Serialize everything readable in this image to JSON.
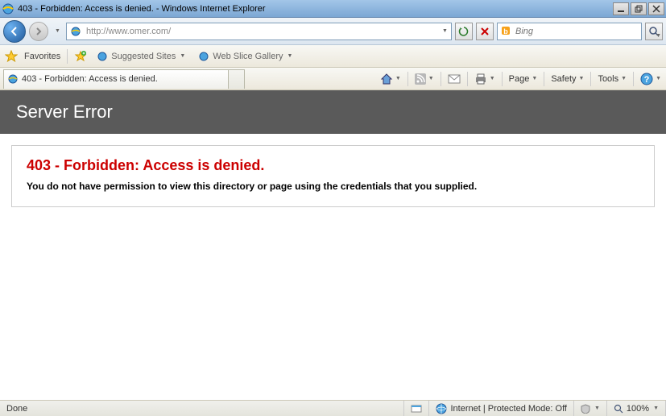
{
  "window": {
    "title": "403 - Forbidden: Access is denied. - Windows Internet Explorer"
  },
  "address": {
    "url": "http://www.omer.com/"
  },
  "search": {
    "placeholder": "Bing"
  },
  "favorites": {
    "label": "Favorites",
    "suggested": "Suggested Sites",
    "webslice": "Web Slice Gallery"
  },
  "tab": {
    "title": "403 - Forbidden: Access is denied."
  },
  "commands": {
    "page": "Page",
    "safety": "Safety",
    "tools": "Tools"
  },
  "error": {
    "header": "Server Error",
    "title": "403 - Forbidden: Access is denied.",
    "body": "You do not have permission to view this directory or page using the credentials that you supplied."
  },
  "status": {
    "done": "Done",
    "zone": "Internet | Protected Mode: Off",
    "zoom": "100%"
  }
}
